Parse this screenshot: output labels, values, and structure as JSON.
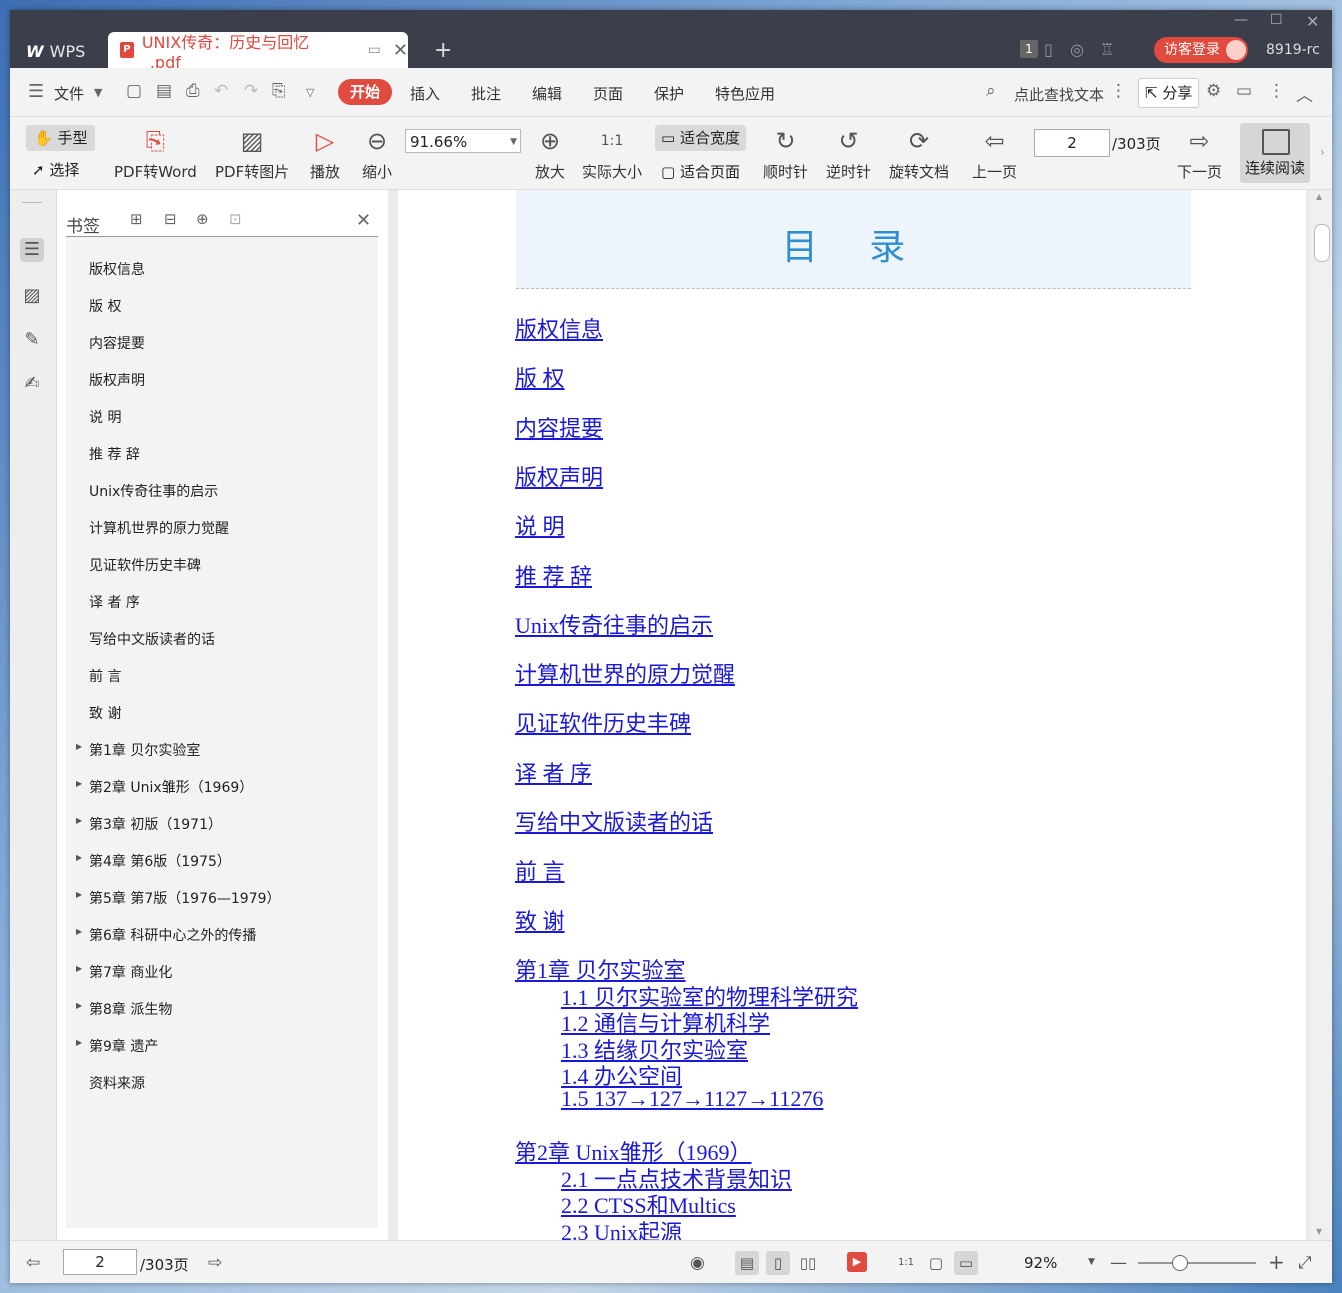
{
  "titlebar": {
    "app_tab": "WPS",
    "doc_tab": "UNIX传奇：历史与回忆_.pdf",
    "tab_count": "1",
    "login": "访客登录",
    "user_id": "8919-rc"
  },
  "menu": {
    "file": "文件",
    "tabs": [
      "开始",
      "插入",
      "批注",
      "编辑",
      "页面",
      "保护",
      "特色应用"
    ],
    "search": "点此查找文本",
    "share": "分享"
  },
  "toolbar": {
    "hand": "手型",
    "select": "选择",
    "pdf_to_word": "PDF转Word",
    "pdf_to_image": "PDF转图片",
    "play": "播放",
    "zoom_out": "缩小",
    "zoom_value": "91.66%",
    "zoom_in": "放大",
    "actual_size": "实际大小",
    "fit_width": "适合宽度",
    "fit_page": "适合页面",
    "clockwise": "顺时针",
    "counter_clockwise": "逆时针",
    "rotate_doc": "旋转文档",
    "prev_page": "上一页",
    "page_value": "2",
    "page_total": "/303页",
    "next_page": "下一页",
    "continuous": "连续阅读"
  },
  "panel": {
    "title": "书签",
    "items": [
      {
        "label": "版权信息",
        "expandable": false
      },
      {
        "label": "版 权",
        "expandable": false
      },
      {
        "label": "内容提要",
        "expandable": false
      },
      {
        "label": "版权声明",
        "expandable": false
      },
      {
        "label": "说 明",
        "expandable": false
      },
      {
        "label": "推 荐 辞",
        "expandable": false
      },
      {
        "label": "Unix传奇往事的启示",
        "expandable": false
      },
      {
        "label": "计算机世界的原力觉醒",
        "expandable": false
      },
      {
        "label": "见证软件历史丰碑",
        "expandable": false
      },
      {
        "label": "译 者 序",
        "expandable": false
      },
      {
        "label": "写给中文版读者的话",
        "expandable": false
      },
      {
        "label": "前 言",
        "expandable": false
      },
      {
        "label": "致 谢",
        "expandable": false
      },
      {
        "label": "第1章 贝尔实验室",
        "expandable": true
      },
      {
        "label": "第2章 Unix雏形（1969）",
        "expandable": true
      },
      {
        "label": "第3章 初版（1971）",
        "expandable": true
      },
      {
        "label": "第4章 第6版（1975）",
        "expandable": true
      },
      {
        "label": "第5章 第7版（1976—1979）",
        "expandable": true
      },
      {
        "label": "第6章 科研中心之外的传播",
        "expandable": true
      },
      {
        "label": "第7章 商业化",
        "expandable": true
      },
      {
        "label": "第8章 派生物",
        "expandable": true
      },
      {
        "label": "第9章 遗产",
        "expandable": true
      },
      {
        "label": "资料来源",
        "expandable": false
      }
    ]
  },
  "document": {
    "toc_title": "目 录",
    "entries": [
      {
        "text": "版权信息",
        "level": 1
      },
      {
        "text": "版 权",
        "level": 1
      },
      {
        "text": "内容提要",
        "level": 1
      },
      {
        "text": "版权声明",
        "level": 1
      },
      {
        "text": "说 明",
        "level": 1
      },
      {
        "text": "推 荐 辞",
        "level": 1
      },
      {
        "text": "Unix传奇往事的启示",
        "level": 1
      },
      {
        "text": "计算机世界的原力觉醒",
        "level": 1
      },
      {
        "text": "见证软件历史丰碑",
        "level": 1
      },
      {
        "text": "译 者 序",
        "level": 1
      },
      {
        "text": "写给中文版读者的话",
        "level": 1
      },
      {
        "text": "前 言",
        "level": 1
      },
      {
        "text": "致 谢",
        "level": 1
      },
      {
        "text": "第1章 贝尔实验室",
        "level": 1
      },
      {
        "text": "1.1 贝尔实验室的物理科学研究",
        "level": 2
      },
      {
        "text": "1.2 通信与计算机科学",
        "level": 2
      },
      {
        "text": "1.3 结缘贝尔实验室",
        "level": 2
      },
      {
        "text": "1.4 办公空间",
        "level": 2
      },
      {
        "text": "1.5 137→127→1127→11276",
        "level": 2
      },
      {
        "text": "第2章 Unix雏形（1969）",
        "level": 1
      },
      {
        "text": "2.1 一点点技术背景知识",
        "level": 2
      },
      {
        "text": "2.2 CTSS和Multics",
        "level": 2
      },
      {
        "text": "2.3 Unix起源",
        "level": 2
      }
    ]
  },
  "status": {
    "page_value": "2",
    "page_total": "/303页",
    "zoom": "92%",
    "zoom_fraction": 0.35
  }
}
